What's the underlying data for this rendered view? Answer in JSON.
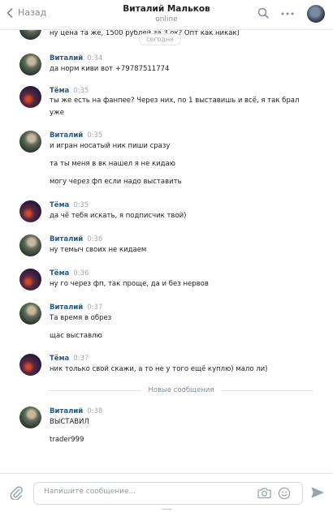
{
  "header": {
    "back_label": "Назад",
    "contact_name": "Виталий Мальков",
    "status": "online"
  },
  "today_label": "сегодня",
  "messages": [
    {
      "sender": "",
      "time": "",
      "avatar": "vitaly",
      "lines": [
        "ну цена та же, 1500 рублей за 3 ок? Опт как никак)"
      ]
    },
    {
      "sender": "Виталий",
      "time": "0:34",
      "avatar": "vitaly",
      "lines": [
        "да норм киви вот +79787511774"
      ]
    },
    {
      "sender": "Тёма",
      "time": "0:35",
      "avatar": "tema",
      "lines": [
        "ты же есть на фанпее? Через них, по 1 выставишь и всё, я так брал уже"
      ]
    },
    {
      "sender": "Виталий",
      "time": "0:35",
      "avatar": "vitaly",
      "lines": [
        "и игран носатый ник пиши сразу",
        "та ты меня в вк нашел я не кидаю",
        "могу через фп если надо выставить"
      ]
    },
    {
      "sender": "Тёма",
      "time": "0:35",
      "avatar": "tema",
      "lines": [
        "да чё тебя искать, я подписчик твой)"
      ]
    },
    {
      "sender": "Виталий",
      "time": "0:36",
      "avatar": "vitaly",
      "lines": [
        "ну темыч своих не кидаем"
      ]
    },
    {
      "sender": "Тёма",
      "time": "0:36",
      "avatar": "tema",
      "lines": [
        "ну го через фп, так проще, да и без нервов"
      ]
    },
    {
      "sender": "Виталий",
      "time": "0:37",
      "avatar": "vitaly",
      "lines": [
        "Та время в обрез",
        "щас выставлю"
      ]
    },
    {
      "sender": "Тёма",
      "time": "0:37",
      "avatar": "tema",
      "lines": [
        "ник только свой скажи, а то не у того ещё куплю) мало ли)"
      ]
    },
    {
      "sender": "Виталий",
      "time": "0:38",
      "avatar": "vitaly",
      "lines": [
        "ВЫСТАВИЛ",
        "trader999"
      ]
    }
  ],
  "new_messages_label": "Новые сообщения",
  "composer": {
    "placeholder": "Напишите сообщение..."
  },
  "icons": [
    "back-icon",
    "search-icon",
    "more-icon",
    "attach-icon",
    "camera-icon",
    "emoji-icon",
    "send-icon"
  ],
  "colors": {
    "name_link": "#2a5885",
    "muted": "#818c99",
    "divider": "#e3e4e8"
  }
}
